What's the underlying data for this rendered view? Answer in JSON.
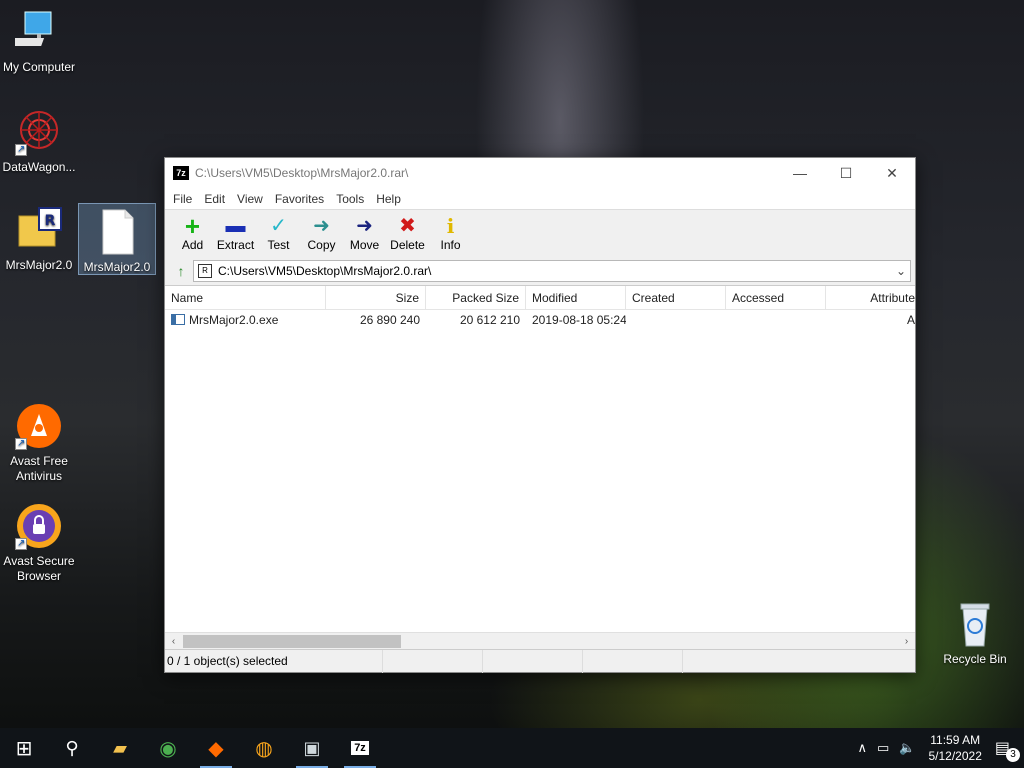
{
  "desktop": {
    "icons": {
      "my_computer": "My Computer",
      "datawagon": "DataWagon...",
      "rar_archive": "MrsMajor2.0",
      "file_selected": "MrsMajor2.0",
      "avast_antivirus": "Avast Free Antivirus",
      "avast_browser": "Avast Secure Browser",
      "recycle_bin": "Recycle Bin"
    }
  },
  "window": {
    "app_icon_text": "7z",
    "title": "C:\\Users\\VM5\\Desktop\\MrsMajor2.0.rar\\",
    "minimize_glyph": "—",
    "maximize_glyph": "☐",
    "close_glyph": "✕",
    "menu": [
      "File",
      "Edit",
      "View",
      "Favorites",
      "Tools",
      "Help"
    ],
    "toolbar": {
      "add": "Add",
      "extract": "Extract",
      "test": "Test",
      "copy": "Copy",
      "move": "Move",
      "delete": "Delete",
      "info": "Info"
    },
    "toolbar_glyphs": {
      "add": "+",
      "extract": "▬",
      "test": "✓",
      "copy": "➜",
      "move": "➜",
      "delete": "✖",
      "info": "i"
    },
    "address": {
      "path": "C:\\Users\\VM5\\Desktop\\MrsMajor2.0.rar\\",
      "icon_text": "R",
      "up_glyph": "↑",
      "dropdown_glyph": "⌄"
    },
    "columns": {
      "name": "Name",
      "size": "Size",
      "packed_size": "Packed Size",
      "modified": "Modified",
      "created": "Created",
      "accessed": "Accessed",
      "attributes": "Attribute"
    },
    "rows": [
      {
        "name": "MrsMajor2.0.exe",
        "size": "26 890 240",
        "packed_size": "20 612 210",
        "modified": "2019-08-18 05:24",
        "created": "",
        "accessed": "",
        "attributes": "A"
      }
    ],
    "scroll": {
      "left": "‹",
      "right": "›"
    },
    "status": {
      "selection": "0 / 1 object(s) selected",
      "cell2": "",
      "cell3": "",
      "cell4": ""
    }
  },
  "taskbar": {
    "start_glyph": "⊞",
    "search_glyph": "⚲",
    "apps": [
      {
        "name": "File Explorer",
        "glyph": "▰"
      },
      {
        "name": "Chrome",
        "glyph": "◉"
      },
      {
        "name": "Avast Antivirus",
        "glyph": "◆"
      },
      {
        "name": "Avast Secure Browser",
        "glyph": "◍"
      },
      {
        "name": "Network",
        "glyph": "▣"
      },
      {
        "name": "7-Zip",
        "glyph": "7z"
      }
    ],
    "tray": {
      "chevron": "∧",
      "network_glyph": "▭",
      "volume_glyph": "🔈",
      "time": "11:59 AM",
      "date": "5/12/2022",
      "notification_glyph": "▤",
      "notification_count": "3"
    }
  },
  "colors": {
    "add_green": "#16b316",
    "extract_blue": "#1a2fb4",
    "test_cyan": "#26b7c9",
    "copy_teal": "#2c8f8f",
    "move_navy": "#1a237e",
    "delete_red": "#d11a1a",
    "info_yellow": "#e0b800"
  }
}
